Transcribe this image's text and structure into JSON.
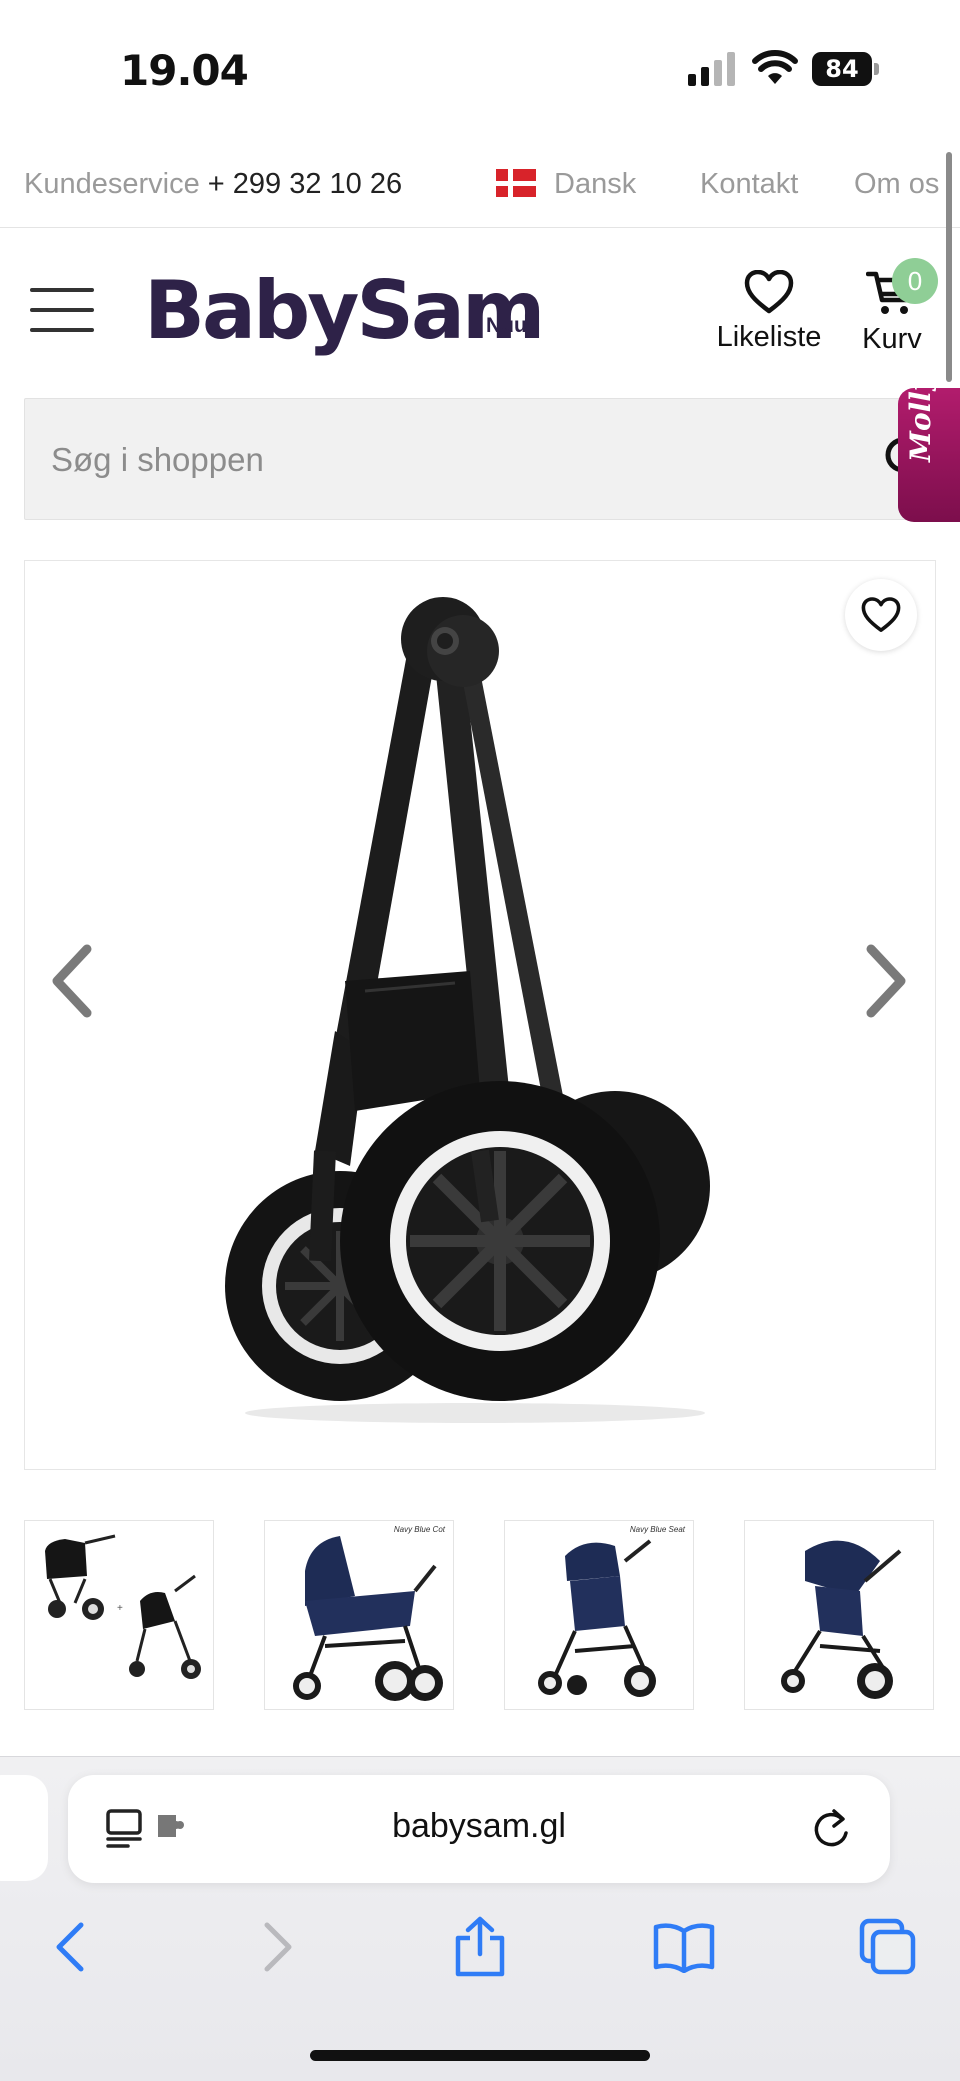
{
  "status_bar": {
    "time": "19.04",
    "battery": "84"
  },
  "topbar": {
    "customer_service_label": "Kundeservice",
    "phone": "+ 299 32 10 26",
    "language": "Dansk",
    "contact": "Kontakt",
    "about": "Om os"
  },
  "header": {
    "logo": "BabySam",
    "logo_sub": "Nuuk",
    "wishlist_label": "Likeliste",
    "cart_label": "Kurv",
    "cart_count": "0"
  },
  "search": {
    "placeholder": "Søg i shoppen"
  },
  "chat": {
    "label": "Molly"
  },
  "gallery": {
    "thumbnail_captions": [
      "",
      "Navy Blue Cot",
      "Navy Blue Seat",
      ""
    ]
  },
  "browser": {
    "url": "babysam.gl"
  },
  "colors": {
    "brand": "#2e2248",
    "cart_badge": "#8fce96",
    "chat_tab": "#a0185f",
    "ios_blue": "#2f7cf6"
  },
  "icons": [
    "signal-icon",
    "wifi-icon",
    "battery-icon",
    "hamburger-menu-icon",
    "heart-icon",
    "cart-icon",
    "search-icon",
    "chevron-left-icon",
    "chevron-right-icon",
    "reader-icon",
    "extension-icon",
    "reload-icon",
    "back-icon",
    "forward-icon",
    "share-icon",
    "bookmarks-icon",
    "tabs-icon"
  ]
}
